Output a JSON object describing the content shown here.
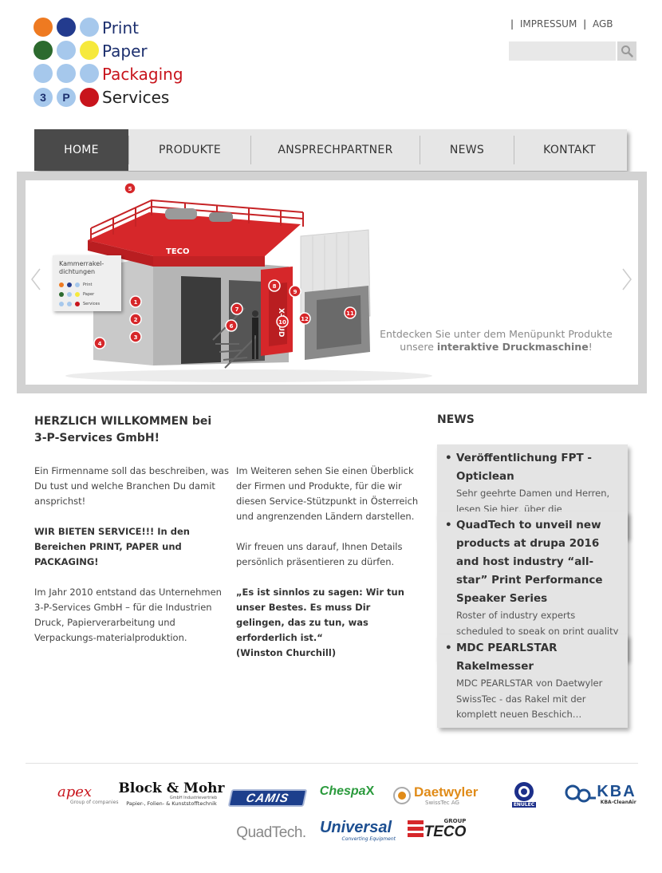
{
  "logo": {
    "lines": [
      "Print",
      "Paper",
      "Packaging",
      "Services"
    ],
    "badge_letters": [
      "3",
      "P"
    ]
  },
  "toplinks": {
    "impressum": "IMPRESSUM",
    "agb": "AGB"
  },
  "search": {
    "placeholder": ""
  },
  "nav": {
    "items": [
      {
        "label": "HOME"
      },
      {
        "label": "PRODUKTE"
      },
      {
        "label": "ANSPRECHPARTNER"
      },
      {
        "label": "NEWS"
      },
      {
        "label": "KONTAKT"
      }
    ]
  },
  "slider": {
    "caption_line1": "Entdecken Sie unter dem Menüpunkt Produkte",
    "caption_line2_pre": "unsere ",
    "caption_line2_bold": "interaktive Druckmaschine",
    "caption_line2_post": "!",
    "callout_title": "Kammerrakel-dichtungen",
    "machine_brand": "TECO",
    "machine_model": "X-TRUD",
    "markers": [
      "1",
      "2",
      "3",
      "4",
      "5",
      "6",
      "7",
      "8",
      "9",
      "10",
      "11",
      "12"
    ]
  },
  "welcome": {
    "title_line1": "HERZLICH WILLKOMMEN bei",
    "title_line2": "3-P-Services GmbH!",
    "p1": "Ein Firmenname soll das beschreiben, was Du tust und welche Branchen Du damit ansprichst!",
    "p2": "WIR BIETEN SERVICE!!! In den Bereichen PRINT, PAPER und PACKAGING!",
    "p3": "Im Jahr 2010 entstand das Unternehmen 3-P-Services GmbH – für die Industrien Druck, Papierverarbeitung und Verpackungs-materialproduktion.",
    "p4": "Im Weiteren sehen Sie einen Überblick der Firmen und Produkte, für die wir diesen Service-Stützpunkt in Österreich und angrenzenden Ländern darstellen.",
    "p5": "Wir freuen uns darauf, Ihnen Details persönlich präsentieren zu dürfen.",
    "quote": "„Es ist sinnlos zu sagen: Wir tun unser Bestes. Es muss Dir gelingen, das zu tun, was erforderlich ist.“",
    "quote_author": "(Winston Churchill)"
  },
  "news": {
    "title": "NEWS",
    "items": [
      {
        "headline": "Veröffentlichung FPT - Opticlean",
        "text": "Sehr geehrte Damen und Herren, lesen Sie hier, über die Veröffentlichung un…"
      },
      {
        "headline": "QuadTech to unveil new products at drupa 2016 and host industry “all-star” Print Performance Speaker Series",
        "text": "Roster of industry experts scheduled to speak on print quality and color science…"
      },
      {
        "headline": "MDC PEARLSTAR Rakelmesser",
        "text": "MDC PEARLSTAR von Daetwyler SwissTec - das Rakel mit der komplett neuen Beschich…"
      }
    ]
  },
  "partners": {
    "apex": "apex",
    "apex_sub": "Group of companies",
    "blockmohr": "Block & Mohr",
    "blockmohr_sub1": "GmbH Industrievertrieb",
    "blockmohr_sub2": "Papier-, Folien- & Kunststofftechnik",
    "camis": "CAMIS",
    "chespa": "Chespa",
    "daetwyler": "Daetwyler",
    "daetwyler_sub": "SwissTec AG",
    "enulec": "ENULEC",
    "kba": "KBA",
    "kba_sub": "KBA-CleanAir",
    "quadtech": "QuadTech.",
    "universal": "Universal",
    "universal_sub": "Converting Equipment",
    "teco": "TECO",
    "teco_group": "GROUP"
  },
  "colors": {
    "logo_blue": "#1c2f6e",
    "logo_red": "#c8141c",
    "nav_active": "#4a4a4a",
    "machine_red": "#d6272a"
  }
}
